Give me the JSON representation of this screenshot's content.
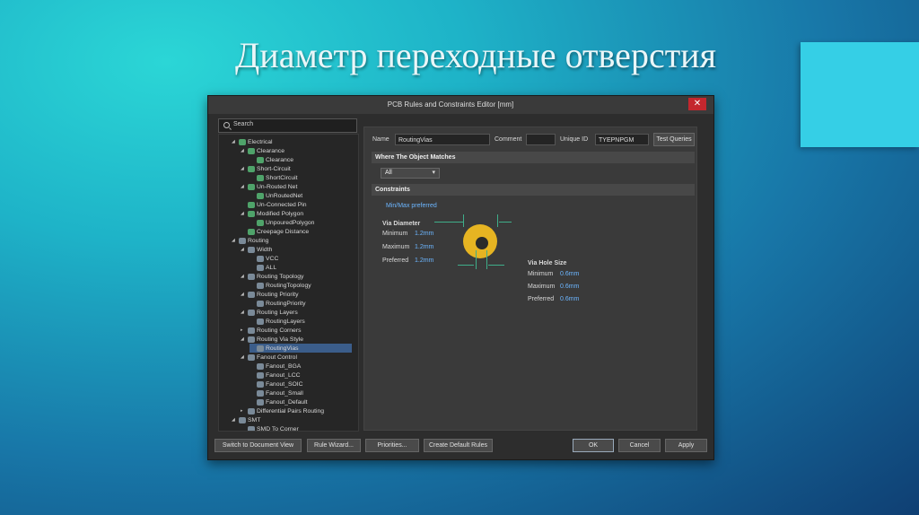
{
  "slide": {
    "title": "Диаметр переходные отверстия"
  },
  "window": {
    "title": "PCB Rules and Constraints Editor [mm]",
    "close": "✕"
  },
  "search": {
    "placeholder": "Search"
  },
  "tree": [
    {
      "label": "Electrical",
      "indent": 0,
      "expander": "◢",
      "icon": "rule"
    },
    {
      "label": "Clearance",
      "indent": 1,
      "expander": "◢",
      "icon": "rule"
    },
    {
      "label": "Clearance",
      "indent": 2,
      "expander": "",
      "icon": "rule"
    },
    {
      "label": "Short-Circuit",
      "indent": 1,
      "expander": "◢",
      "icon": "rule"
    },
    {
      "label": "ShortCircuit",
      "indent": 2,
      "expander": "",
      "icon": "rule"
    },
    {
      "label": "Un-Routed Net",
      "indent": 1,
      "expander": "◢",
      "icon": "rule"
    },
    {
      "label": "UnRoutedNet",
      "indent": 2,
      "expander": "",
      "icon": "rule"
    },
    {
      "label": "Un-Connected Pin",
      "indent": 1,
      "expander": "",
      "icon": "rule"
    },
    {
      "label": "Modified Polygon",
      "indent": 1,
      "expander": "◢",
      "icon": "rule"
    },
    {
      "label": "UnpouredPolygon",
      "indent": 2,
      "expander": "",
      "icon": "rule"
    },
    {
      "label": "Creepage Distance",
      "indent": 1,
      "expander": "",
      "icon": "rule"
    },
    {
      "label": "Routing",
      "indent": 0,
      "expander": "◢",
      "icon": "route"
    },
    {
      "label": "Width",
      "indent": 1,
      "expander": "◢",
      "icon": "route"
    },
    {
      "label": "VCC",
      "indent": 2,
      "expander": "",
      "icon": "route"
    },
    {
      "label": "ALL",
      "indent": 2,
      "expander": "",
      "icon": "route"
    },
    {
      "label": "Routing Topology",
      "indent": 1,
      "expander": "◢",
      "icon": "route"
    },
    {
      "label": "RoutingTopology",
      "indent": 2,
      "expander": "",
      "icon": "route"
    },
    {
      "label": "Routing Priority",
      "indent": 1,
      "expander": "◢",
      "icon": "route"
    },
    {
      "label": "RoutingPriority",
      "indent": 2,
      "expander": "",
      "icon": "route"
    },
    {
      "label": "Routing Layers",
      "indent": 1,
      "expander": "◢",
      "icon": "route"
    },
    {
      "label": "RoutingLayers",
      "indent": 2,
      "expander": "",
      "icon": "route"
    },
    {
      "label": "Routing Corners",
      "indent": 1,
      "expander": "▸",
      "icon": "route"
    },
    {
      "label": "Routing Via Style",
      "indent": 1,
      "expander": "◢",
      "icon": "route"
    },
    {
      "label": "RoutingVias",
      "indent": 2,
      "expander": "",
      "icon": "route",
      "selected": true
    },
    {
      "label": "Fanout Control",
      "indent": 1,
      "expander": "◢",
      "icon": "route"
    },
    {
      "label": "Fanout_BGA",
      "indent": 2,
      "expander": "",
      "icon": "route"
    },
    {
      "label": "Fanout_LCC",
      "indent": 2,
      "expander": "",
      "icon": "route"
    },
    {
      "label": "Fanout_SOIC",
      "indent": 2,
      "expander": "",
      "icon": "route"
    },
    {
      "label": "Fanout_Small",
      "indent": 2,
      "expander": "",
      "icon": "route"
    },
    {
      "label": "Fanout_Default",
      "indent": 2,
      "expander": "",
      "icon": "route"
    },
    {
      "label": "Differential Pairs Routing",
      "indent": 1,
      "expander": "▸",
      "icon": "route"
    },
    {
      "label": "SMT",
      "indent": 0,
      "expander": "◢",
      "icon": "route"
    },
    {
      "label": "SMD To Corner",
      "indent": 1,
      "expander": "",
      "icon": "route"
    }
  ],
  "rule": {
    "name_label": "Name",
    "name_value": "RoutingVias",
    "comment_label": "Comment",
    "comment_value": "",
    "uid_label": "Unique ID",
    "uid_value": "TYEPNPGM",
    "test_queries": "Test Queries"
  },
  "where": {
    "header": "Where The Object Matches",
    "dropdown": "All"
  },
  "constraints": {
    "header": "Constraints",
    "mode": "Min/Max preferred",
    "via_diameter": {
      "title": "Via Diameter",
      "min_label": "Minimum",
      "min": "1.2mm",
      "max_label": "Maximum",
      "max": "1.2mm",
      "pref_label": "Preferred",
      "pref": "1.2mm"
    },
    "via_hole": {
      "title": "Via Hole Size",
      "min_label": "Minimum",
      "min": "0.6mm",
      "max_label": "Maximum",
      "max": "0.6mm",
      "pref_label": "Preferred",
      "pref": "0.6mm"
    }
  },
  "footer": {
    "switch": "Switch to Document View",
    "wizard": "Rule Wizard...",
    "priorities": "Priorities...",
    "create_default": "Create Default Rules",
    "ok": "OK",
    "cancel": "Cancel",
    "apply": "Apply"
  },
  "colors": {
    "via_copper": "#e6b422",
    "dimension_line": "#3fae8a",
    "accent_value": "#6cb6ff",
    "selected_row": "#3b5d8a"
  }
}
